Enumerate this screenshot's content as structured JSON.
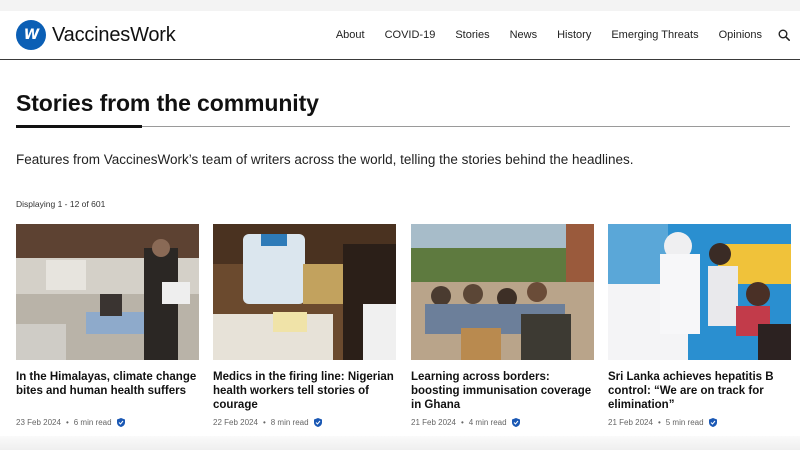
{
  "site": {
    "logo_mark": "W",
    "name": "VaccinesWork"
  },
  "nav": {
    "items": [
      "About",
      "COVID-19",
      "Stories",
      "News",
      "History",
      "Emerging Threats",
      "Opinions"
    ],
    "search_icon": "search-icon"
  },
  "page": {
    "title": "Stories from the community",
    "intro": "Features from VaccinesWork’s team of writers across the world, telling the stories behind the headlines.",
    "result_count": "Displaying 1 - 12 of 601"
  },
  "cards": [
    {
      "title": "In the Himalayas, climate change bites and human health suffers",
      "date": "23 Feb 2024",
      "read_time": "6 min read",
      "image": "hospital-ward-photo",
      "colors": [
        "#d9d5cf",
        "#5a4536",
        "#8aa9c7",
        "#2c2926"
      ]
    },
    {
      "title": "Medics in the firing line: Nigerian health workers tell stories of courage",
      "date": "22 Feb 2024",
      "read_time": "8 min read",
      "image": "vaccine-cooler-photo",
      "colors": [
        "#6b4a2e",
        "#a9c6d6",
        "#2e7bb8",
        "#3b2a1f"
      ]
    },
    {
      "title": "Learning across borders: boosting immunisation coverage in Ghana",
      "date": "21 Feb 2024",
      "read_time": "4 min read",
      "image": "community-meeting-photo",
      "colors": [
        "#a5b9c6",
        "#6f7a46",
        "#b0755a",
        "#3f3a33"
      ]
    },
    {
      "title": "Sri Lanka achieves hepatitis B control: “We are on track for elimination”",
      "date": "21 Feb 2024",
      "read_time": "5 min read",
      "image": "nurse-vaccinating-child-photo",
      "colors": [
        "#2a8fd0",
        "#f4f4f6",
        "#c23b4a",
        "#3a2b25"
      ]
    }
  ],
  "theme": {
    "brand_blue": "#0b5fb5",
    "verified_icon": "shield-check-icon"
  }
}
